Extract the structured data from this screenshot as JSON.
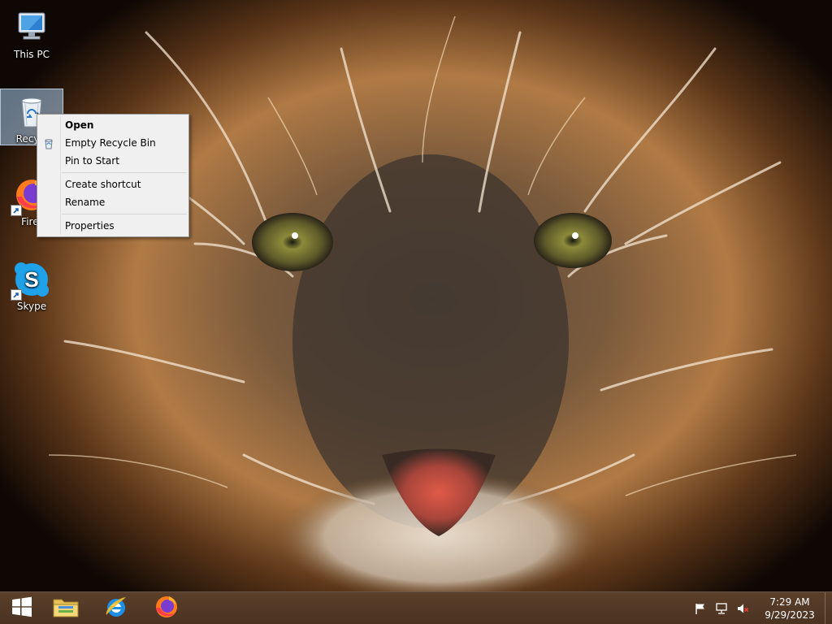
{
  "desktop": {
    "icons": [
      {
        "label": "This PC",
        "icon": "computer-icon"
      },
      {
        "label": "Recycle Bin",
        "icon": "recycle-bin-icon",
        "shown_label": "Recycl"
      },
      {
        "label": "Firefox",
        "icon": "firefox-icon",
        "shown_label": "Firef"
      },
      {
        "label": "Skype",
        "icon": "skype-icon"
      }
    ]
  },
  "context_menu": {
    "items": [
      {
        "label": "Open",
        "bold": true
      },
      {
        "label": "Empty Recycle Bin",
        "icon": "recycle-bin-icon"
      },
      {
        "label": "Pin to Start"
      },
      {
        "label": "Create shortcut"
      },
      {
        "label": "Rename"
      },
      {
        "label": "Properties"
      }
    ]
  },
  "taskbar": {
    "start_icon": "windows-logo-icon",
    "pinned": [
      {
        "name": "File Explorer",
        "icon": "folder-icon"
      },
      {
        "name": "Internet Explorer",
        "icon": "internet-explorer-icon"
      },
      {
        "name": "Firefox",
        "icon": "firefox-icon"
      }
    ],
    "tray_icons": [
      "flag-icon",
      "network-icon",
      "volume-muted-icon"
    ],
    "clock": {
      "time": "7:29 AM",
      "date": "9/29/2023"
    }
  },
  "colors": {
    "taskbar": "#4f3624",
    "menu_background": "#f0f0f0",
    "selection": "#aacdf0"
  }
}
